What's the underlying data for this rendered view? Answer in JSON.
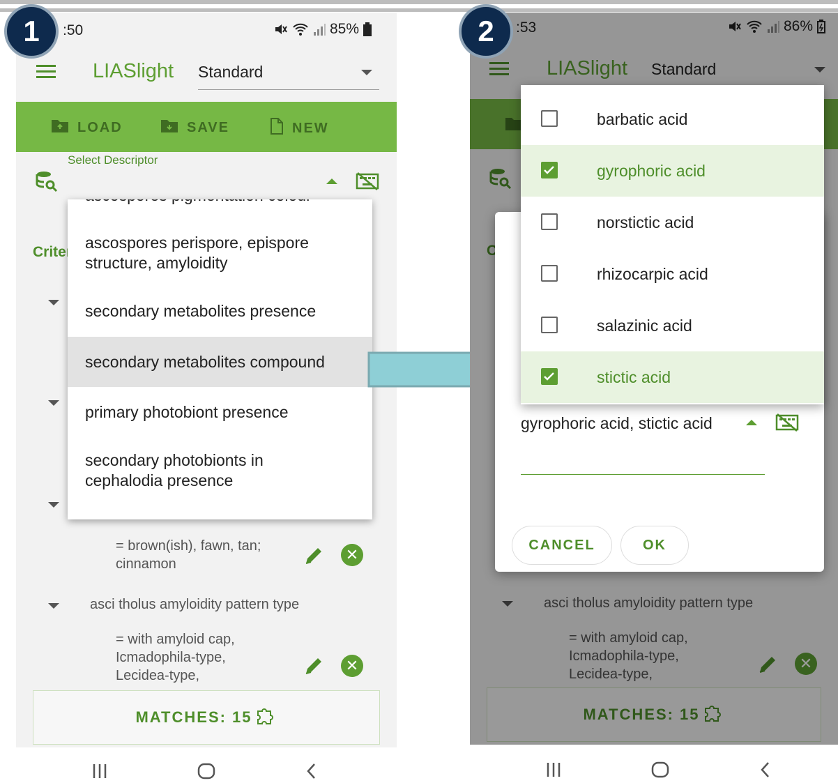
{
  "panel1": {
    "badge": "1",
    "status_time": ":50",
    "status_battery": "85%",
    "app_title": "LIASlight",
    "mode_select": "Standard",
    "toolbar": {
      "load": "LOAD",
      "save": "SAVE",
      "new": "NEW"
    },
    "select_descriptor_label": "Select Descriptor",
    "dropdown_partial_item": "ascospores pigmentation colour",
    "dropdown_items": [
      "ascospores perispore, epispore structure, amyloidity",
      "secondary metabolites presence",
      "secondary metabolites compound",
      "primary photobiont presence",
      "secondary photobionts in cephalodia presence"
    ],
    "selected_item_index": 2,
    "criteria_label_partial": "Criter",
    "criteria": [
      {
        "value": "= brown(ish), fawn, tan; cinnamon"
      },
      {
        "title": "asci tholus amyloidity pattern type",
        "value": "= with amyloid cap, Icmadophila-type, Lecidea-type,"
      }
    ],
    "matches": "MATCHES: 15"
  },
  "panel2": {
    "badge": "2",
    "status_time": ":53",
    "status_battery": "86%",
    "app_title": "LIASlight",
    "mode_select": "Standard",
    "criteria_label_partial": "C",
    "options": [
      {
        "label": "barbatic acid",
        "checked": false
      },
      {
        "label": "gyrophoric acid",
        "checked": true
      },
      {
        "label": "norstictic acid",
        "checked": false
      },
      {
        "label": "rhizocarpic acid",
        "checked": false
      },
      {
        "label": "salazinic acid",
        "checked": false
      },
      {
        "label": "stictic acid",
        "checked": true
      }
    ],
    "selected_value": "gyrophoric acid, stictic acid",
    "cancel": "CANCEL",
    "ok": "OK",
    "criteria_title": "asci tholus amyloidity pattern type",
    "criteria_value": "= with amyloid cap, Icmadophila-type, Lecidea-type,",
    "matches": "MATCHES: 15"
  },
  "colors": {
    "accent": "#5d9e32",
    "toolbar": "#76b845",
    "badge": "#0e2a4d",
    "arrow": "#8ecfd6"
  }
}
